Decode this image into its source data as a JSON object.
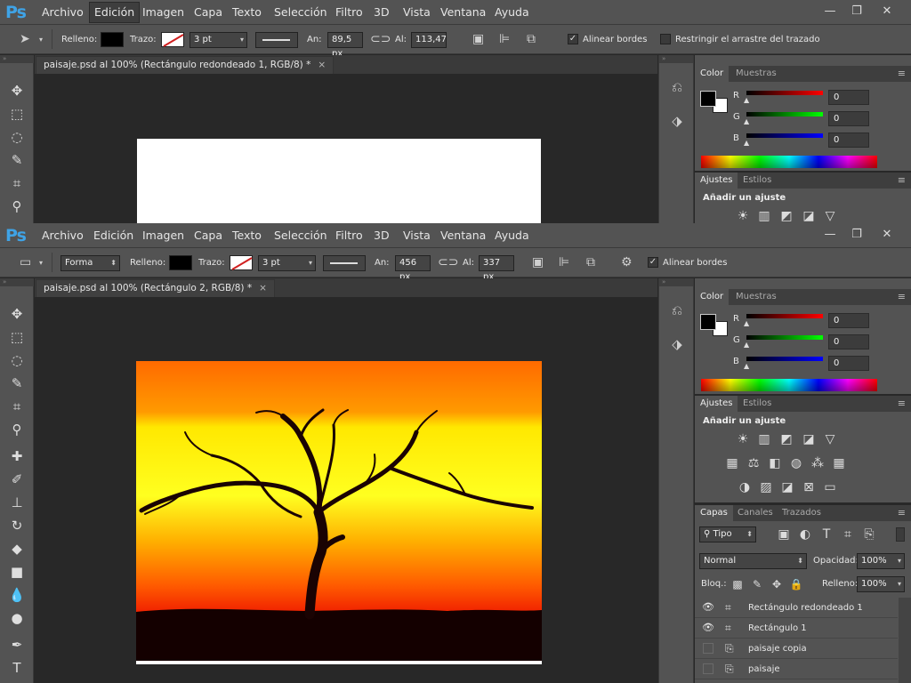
{
  "app": {
    "logo": "Ps"
  },
  "menu": [
    "Archivo",
    "Edición",
    "Imagen",
    "Capa",
    "Texto",
    "Selección",
    "Filtro",
    "3D",
    "Vista",
    "Ventana",
    "Ayuda"
  ],
  "window_controls": {
    "minimize": "—",
    "restore": "❐",
    "close": "✕"
  },
  "top": {
    "options": {
      "fill_label": "Relleno:",
      "stroke_label": "Trazo:",
      "stroke_size": "3 pt",
      "w_label": "An:",
      "w_value": "89,5 px",
      "h_label": "Al:",
      "h_value": "113,47",
      "align_edges": "Alinear bordes",
      "constrain": "Restringir el arrastre del trazado"
    },
    "doc_tab": "paisaje.psd al 100% (Rectángulo redondeado 1, RGB/8) *",
    "adjust_title": "Añadir un ajuste"
  },
  "bottom": {
    "options": {
      "mode": "Forma",
      "fill_label": "Relleno:",
      "stroke_label": "Trazo:",
      "stroke_size": "3 pt",
      "w_label": "An:",
      "w_value": "456 px",
      "h_label": "Al:",
      "h_value": "337 px",
      "align_edges": "Alinear bordes"
    },
    "doc_tab": "paisaje.psd al 100% (Rectángulo 2, RGB/8) *",
    "adjust_title": "Añadir un ajuste"
  },
  "close_glyph": "×",
  "panels": {
    "color_tab": "Color",
    "swatches_tab": "Muestras",
    "channels": [
      "R",
      "G",
      "B"
    ],
    "channel_values": [
      "0",
      "0",
      "0"
    ],
    "adjust_tab": "Ajustes",
    "styles_tab": "Estilos",
    "layers_tab": "Capas",
    "channels_tab": "Canales",
    "paths_tab": "Trazados",
    "kind_filter": "Tipo",
    "blend_mode": "Normal",
    "opacity_label": "Opacidad:",
    "opacity_value": "100%",
    "lock_label": "Bloq.:",
    "fill_label": "Relleno:",
    "fill_value": "100%",
    "layers": [
      {
        "name": "Rectángulo redondeado 1",
        "visible": true,
        "icon": "shape-layer-icon"
      },
      {
        "name": "Rectángulo 1",
        "visible": true,
        "icon": "shape-layer-icon"
      },
      {
        "name": "paisaje copia",
        "visible": false,
        "icon": "document-icon"
      },
      {
        "name": "paisaje",
        "visible": false,
        "icon": "document-icon"
      }
    ]
  },
  "colors": {
    "ui_bg": "#535353",
    "canvas_bg": "#282828",
    "accent": "#3fa3e6",
    "foreground": "#000000",
    "background": "#ffffff"
  }
}
